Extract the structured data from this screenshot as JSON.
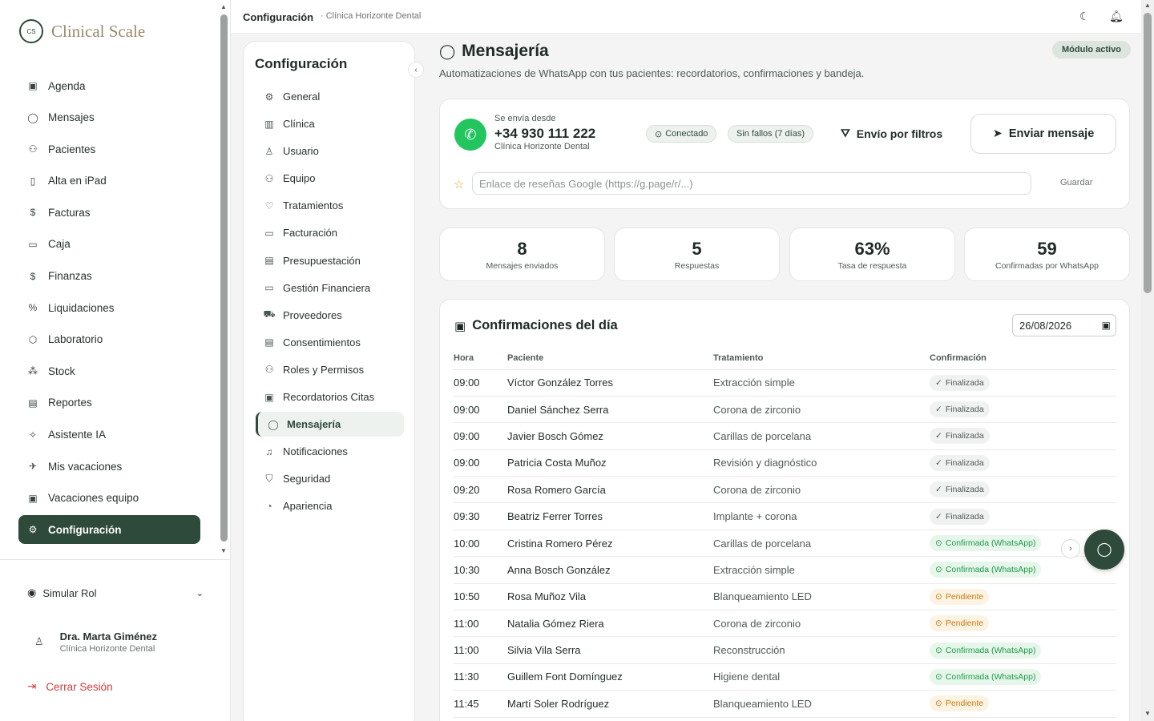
{
  "brand": {
    "mark": "CS",
    "name": "Clinical Scale"
  },
  "nav": [
    {
      "label": "Agenda",
      "icon": "calendar-icon",
      "glyph": "▣"
    },
    {
      "label": "Mensajes",
      "icon": "chat-icon",
      "glyph": "◯"
    },
    {
      "label": "Pacientes",
      "icon": "users-icon",
      "glyph": "⚇"
    },
    {
      "label": "Alta en iPad",
      "icon": "tablet-icon",
      "glyph": "▯"
    },
    {
      "label": "Facturas",
      "icon": "invoice-icon",
      "glyph": "$"
    },
    {
      "label": "Caja",
      "icon": "wallet-icon",
      "glyph": "▭"
    },
    {
      "label": "Finanzas",
      "icon": "dollar-icon",
      "glyph": "$"
    },
    {
      "label": "Liquidaciones",
      "icon": "percent-icon",
      "glyph": "%"
    },
    {
      "label": "Laboratorio",
      "icon": "cube-icon",
      "glyph": "⬡"
    },
    {
      "label": "Stock",
      "icon": "boxes-icon",
      "glyph": "⁂"
    },
    {
      "label": "Reportes",
      "icon": "report-icon",
      "glyph": "▤"
    },
    {
      "label": "Asistente IA",
      "icon": "sparkles-icon",
      "glyph": "✧"
    },
    {
      "label": "Mis vacaciones",
      "icon": "plane-icon",
      "glyph": "✈"
    },
    {
      "label": "Vacaciones equipo",
      "icon": "calendar-team-icon",
      "glyph": "▣"
    },
    {
      "label": "Configuración",
      "icon": "gear-icon",
      "glyph": "⚙",
      "active": true
    }
  ],
  "simulate_role": "Simular Rol",
  "user": {
    "name": "Dra. Marta Giménez",
    "clinic": "Clínica Horizonte Dental"
  },
  "logout": "Cerrar Sesión",
  "breadcrumb": {
    "main": "Configuración",
    "sub": "· Clínica Horizonte Dental"
  },
  "config": {
    "title": "Configuración",
    "items": [
      {
        "label": "General",
        "icon": "gear-icon",
        "glyph": "⚙"
      },
      {
        "label": "Clínica",
        "icon": "building-icon",
        "glyph": "▥"
      },
      {
        "label": "Usuario",
        "icon": "user-icon",
        "glyph": "♙"
      },
      {
        "label": "Equipo",
        "icon": "team-icon",
        "glyph": "⚇"
      },
      {
        "label": "Tratamientos",
        "icon": "stethoscope-icon",
        "glyph": "♡"
      },
      {
        "label": "Facturación",
        "icon": "credit-card-icon",
        "glyph": "▭"
      },
      {
        "label": "Presupuestación",
        "icon": "document-icon",
        "glyph": "▤"
      },
      {
        "label": "Gestión Financiera",
        "icon": "wallet-icon",
        "glyph": "▭"
      },
      {
        "label": "Proveedores",
        "icon": "truck-icon",
        "glyph": "⛟"
      },
      {
        "label": "Consentimientos",
        "icon": "signed-doc-icon",
        "glyph": "▤"
      },
      {
        "label": "Roles y Permisos",
        "icon": "roles-icon",
        "glyph": "⚇"
      },
      {
        "label": "Recordatorios Citas",
        "icon": "calendar-icon",
        "glyph": "▣"
      },
      {
        "label": "Mensajería",
        "icon": "chat-icon",
        "glyph": "◯",
        "active": true
      },
      {
        "label": "Notificaciones",
        "icon": "bell-icon",
        "glyph": "♫"
      },
      {
        "label": "Seguridad",
        "icon": "shield-icon",
        "glyph": "⛉"
      },
      {
        "label": "Apariencia",
        "icon": "palette-icon",
        "glyph": "◔"
      }
    ]
  },
  "page": {
    "title": "Mensajería",
    "subtitle": "Automatizaciones de WhatsApp con tus pacientes: recordatorios, confirmaciones y bandeja.",
    "badge": "Módulo activo"
  },
  "sender": {
    "label": "Se envía desde",
    "phone": "+34 930 111 222",
    "clinic": "Clínica Horizonte Dental",
    "status": "Conectado",
    "failures": "Sin fallos (7 días)",
    "filter_button": "Envío por filtros",
    "send_button": "Enviar mensaje",
    "review_placeholder": "Enlace de reseñas Google (https://g.page/r/...)",
    "save": "Guardar"
  },
  "stats": [
    {
      "value": "8",
      "label": "Mensajes enviados"
    },
    {
      "value": "5",
      "label": "Respuestas"
    },
    {
      "value": "63%",
      "label": "Tasa de respuesta"
    },
    {
      "value": "59",
      "label": "Confirmadas por WhatsApp"
    }
  ],
  "confirmations": {
    "title": "Confirmaciones del día",
    "date": "26/08/2026",
    "headers": [
      "Hora",
      "Paciente",
      "Tratamiento",
      "Confirmación"
    ],
    "rows": [
      {
        "time": "09:00",
        "patient": "Víctor González Torres",
        "treatment": "Extracción simple",
        "status": "Finalizada",
        "kind": "final"
      },
      {
        "time": "09:00",
        "patient": "Daniel Sánchez Serra",
        "treatment": "Corona de zirconio",
        "status": "Finalizada",
        "kind": "final"
      },
      {
        "time": "09:00",
        "patient": "Javier Bosch Gómez",
        "treatment": "Carillas de porcelana",
        "status": "Finalizada",
        "kind": "final"
      },
      {
        "time": "09:00",
        "patient": "Patricia Costa Muñoz",
        "treatment": "Revisión y diagnóstico",
        "status": "Finalizada",
        "kind": "final"
      },
      {
        "time": "09:20",
        "patient": "Rosa Romero García",
        "treatment": "Corona de zirconio",
        "status": "Finalizada",
        "kind": "final"
      },
      {
        "time": "09:30",
        "patient": "Beatriz Ferrer Torres",
        "treatment": "Implante + corona",
        "status": "Finalizada",
        "kind": "final"
      },
      {
        "time": "10:00",
        "patient": "Cristina Romero Pérez",
        "treatment": "Carillas de porcelana",
        "status": "Confirmada (WhatsApp)",
        "kind": "conf"
      },
      {
        "time": "10:30",
        "patient": "Anna Bosch González",
        "treatment": "Extracción simple",
        "status": "Confirmada (WhatsApp)",
        "kind": "conf"
      },
      {
        "time": "10:50",
        "patient": "Rosa Muñoz Vila",
        "treatment": "Blanqueamiento LED",
        "status": "Pendiente",
        "kind": "pend"
      },
      {
        "time": "11:00",
        "patient": "Natalia Gómez Riera",
        "treatment": "Corona de zirconio",
        "status": "Pendiente",
        "kind": "pend"
      },
      {
        "time": "11:00",
        "patient": "Silvia Vila Serra",
        "treatment": "Reconstrucción",
        "status": "Confirmada (WhatsApp)",
        "kind": "conf"
      },
      {
        "time": "11:30",
        "patient": "Guillem Font Domínguez",
        "treatment": "Higiene dental",
        "status": "Confirmada (WhatsApp)",
        "kind": "conf"
      },
      {
        "time": "11:45",
        "patient": "Martí Soler Rodríguez",
        "treatment": "Blanqueamiento LED",
        "status": "Pendiente",
        "kind": "pend"
      }
    ]
  }
}
